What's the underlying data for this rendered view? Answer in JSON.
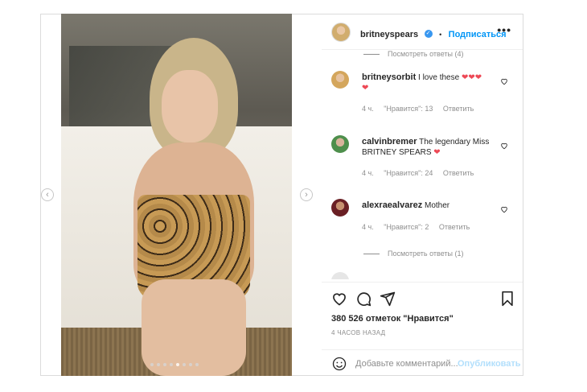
{
  "post": {
    "username": "britneyspears",
    "follow_label": "Подписаться",
    "more_label": "•••",
    "verified_label": "✓"
  },
  "comments": {
    "view_replies_top": "Посмотреть ответы (4)",
    "items": [
      {
        "username": "britneysorbit",
        "text": "I love these",
        "hearts": "❤❤❤ ❤",
        "time": "4 ч.",
        "likes": "\"Нравится\": 13",
        "reply": "Ответить"
      },
      {
        "username": "calvinbremer",
        "text": "The legendary Miss BRITNEY SPEARS",
        "hearts": "❤",
        "time": "4 ч.",
        "likes": "\"Нравится\": 24",
        "reply": "Ответить"
      },
      {
        "username": "alexraealvarez",
        "text": "Mother",
        "hearts": "",
        "time": "4 ч.",
        "likes": "\"Нравится\": 2",
        "reply": "Ответить"
      }
    ],
    "view_replies_bottom": "Посмотреть ответы (1)"
  },
  "actions": {
    "likes_count": "380 526 отметок \"Нравится\"",
    "posted_time": "4 ЧАСОВ НАЗАД"
  },
  "add_comment": {
    "placeholder": "Добавьте комментарий...",
    "publish_label": "Опубликовать"
  },
  "carousel": {
    "dot_count": 8,
    "active_index": 4
  }
}
